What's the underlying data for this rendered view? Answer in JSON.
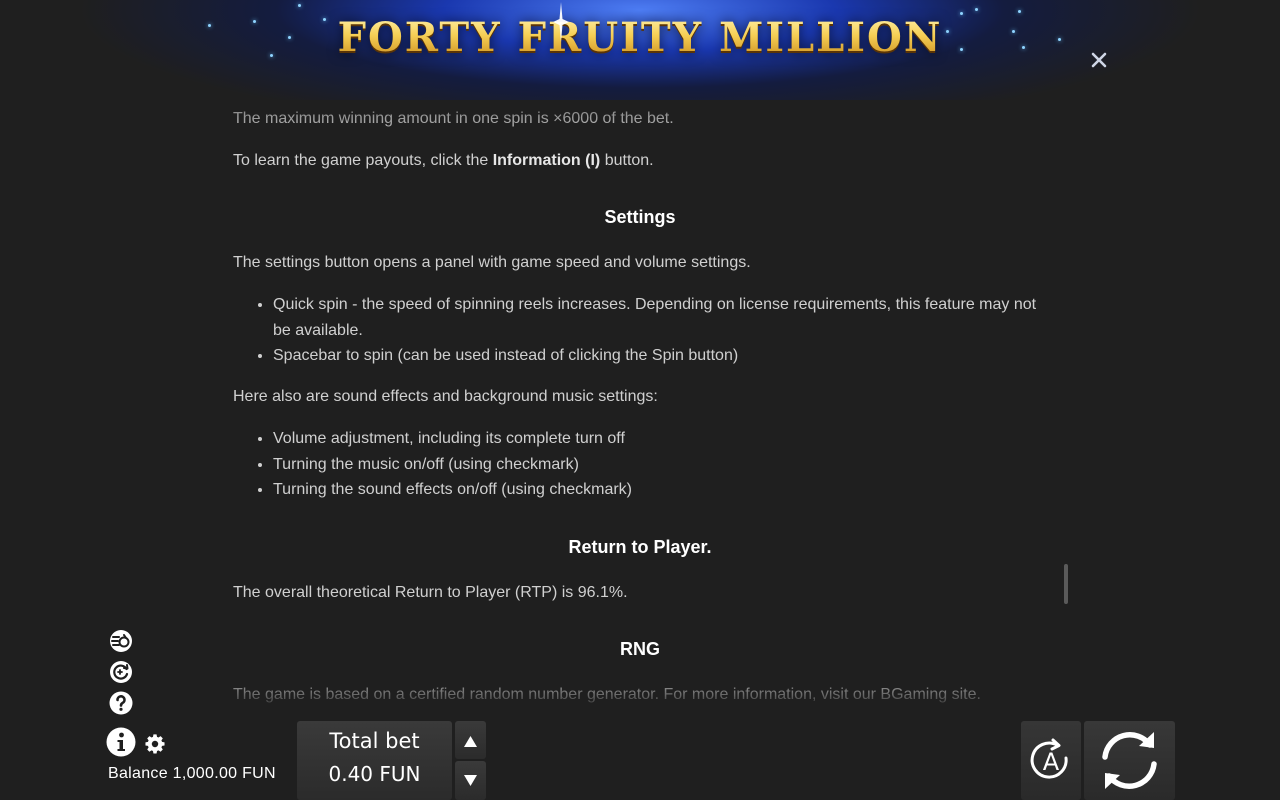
{
  "header": {
    "title": "FORTY FRUITY MILLION",
    "close_icon": "close-icon",
    "accent_colors": {
      "title_gold": "#f3c84a",
      "banner_blue": "#1e3fd0"
    }
  },
  "content": {
    "max_win_text": "The maximum winning amount in one spin is ×6000 of the bet.",
    "payouts_text_pre": "To learn the game payouts, click the ",
    "payouts_text_bold": "Information (I)",
    "payouts_text_post": " button.",
    "settings_heading": "Settings",
    "settings_intro": "The settings button opens a panel with game speed and volume settings.",
    "settings_bullets": [
      "Quick spin - the speed of spinning reels increases. Depending on license requirements, this feature may not be available.",
      "Spacebar to spin (can be used instead of clicking the Spin button)"
    ],
    "sound_intro": "Here also are sound effects and background music settings:",
    "sound_bullets": [
      "Volume adjustment, including its complete turn off",
      "Turning the music on/off (using checkmark)",
      "Turning the sound effects on/off (using checkmark)"
    ],
    "rtp_heading": "Return to Player.",
    "rtp_text": "The overall theoretical Return to Player (RTP) is 96.1%.",
    "rng_heading": "RNG",
    "rng_text": "The game is based on a certified random number generator. For more information, visit our BGaming site."
  },
  "controls": {
    "left_icons": [
      "quick-spin-icon",
      "autoplay-history-icon",
      "help-icon",
      "info-icon",
      "gear-icon"
    ],
    "balance_label": "Balance 1,000.00 FUN",
    "bet_title": "Total bet",
    "bet_value": "0.40 FUN",
    "bet_up_icon": "triangle-up-icon",
    "bet_down_icon": "triangle-down-icon",
    "auto_label": "A",
    "spin_icon": "spin-arrows-icon"
  }
}
